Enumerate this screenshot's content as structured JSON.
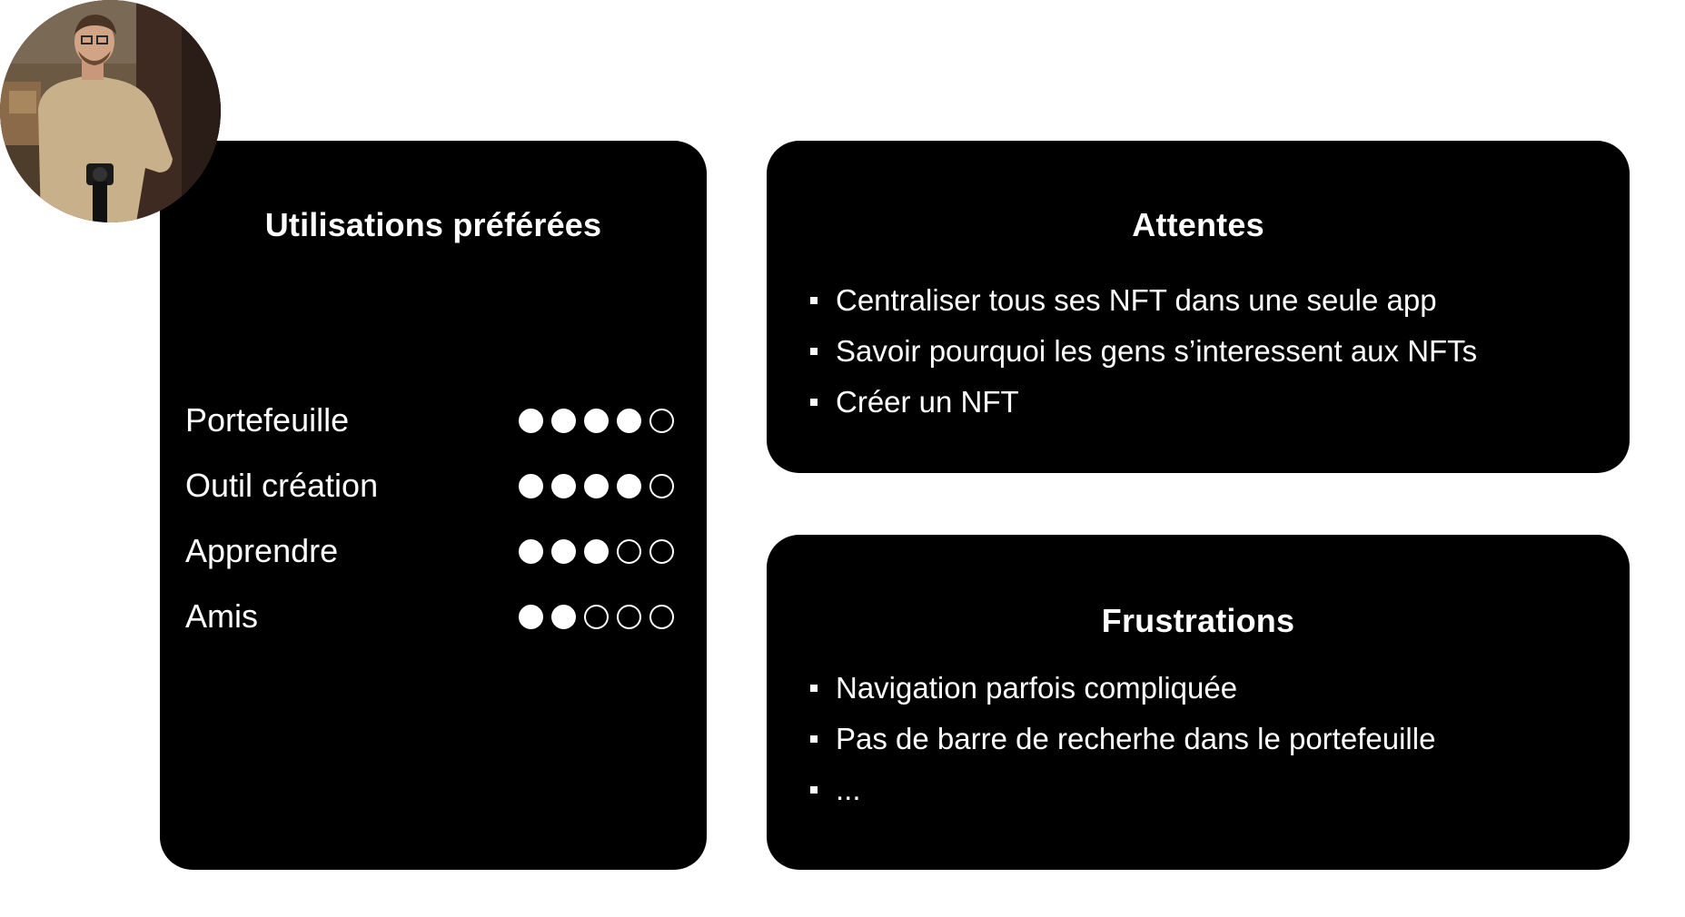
{
  "avatar": {
    "icon": "person-photo"
  },
  "usage": {
    "title": "Utilisations préférées",
    "items": [
      {
        "label": "Portefeuille",
        "rating": 4,
        "max": 5
      },
      {
        "label": "Outil création",
        "rating": 4,
        "max": 5
      },
      {
        "label": "Apprendre",
        "rating": 3,
        "max": 5
      },
      {
        "label": "Amis",
        "rating": 2,
        "max": 5
      }
    ]
  },
  "expectations": {
    "title": "Attentes",
    "items": [
      "Centraliser tous ses NFT dans une seule app",
      "Savoir pourquoi les gens s’interessent aux NFTs",
      "Créer un NFT"
    ]
  },
  "frustrations": {
    "title": "Frustrations",
    "items": [
      "Navigation parfois compliquée",
      "Pas de barre de recherhe dans le portefeuille",
      "..."
    ]
  },
  "colors": {
    "card": "#000000",
    "text": "#ffffff",
    "background": "#ffffff"
  }
}
